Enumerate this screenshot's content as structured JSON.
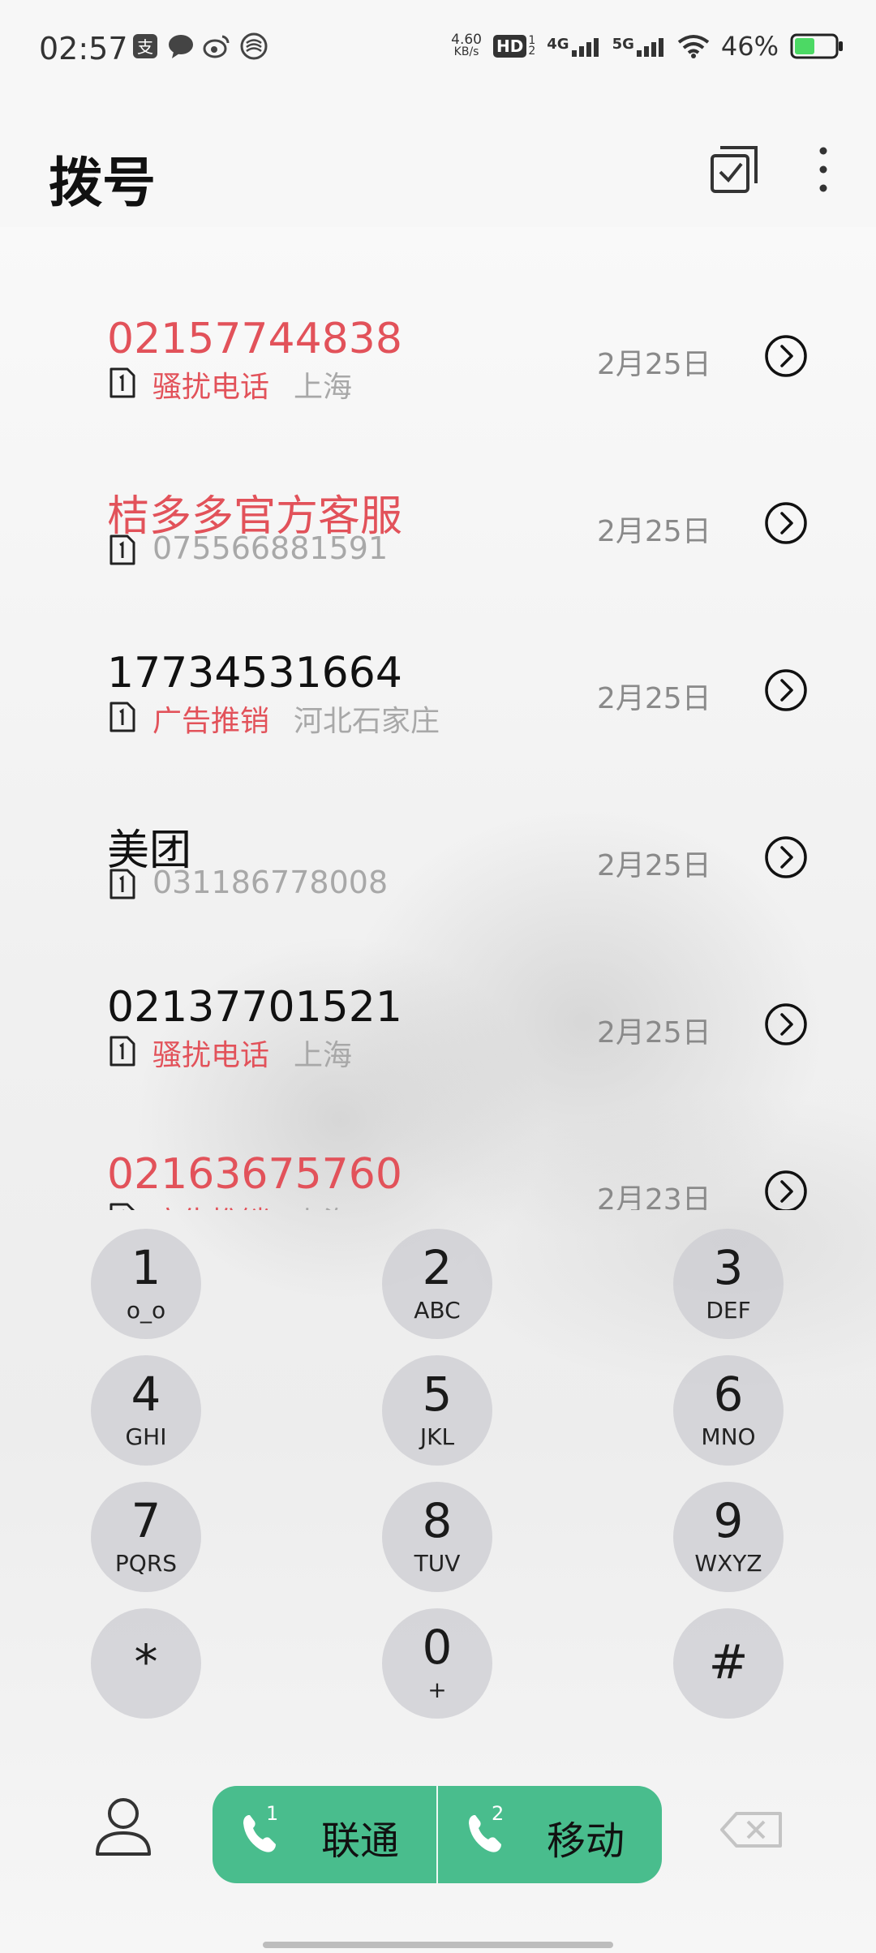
{
  "status_bar": {
    "time": "02:57",
    "net_speed_value": "4.60",
    "net_speed_unit": "KB/s",
    "hd_label": "HD",
    "network_1": "4G",
    "network_2": "5G",
    "battery": "46%",
    "icons": [
      "alipay-icon",
      "message-icon",
      "weibo-icon",
      "mobile-app-icon",
      "wifi-icon",
      "battery-icon"
    ]
  },
  "header": {
    "title": "拨号",
    "icons": [
      "multi-select-icon",
      "more-icon"
    ]
  },
  "calls": [
    {
      "name": "02157744838",
      "name_color": "red",
      "tag": "骚扰电话",
      "location": "上海",
      "number": "",
      "date": "2月25日"
    },
    {
      "name": "桔多多官方客服",
      "name_color": "red",
      "tag": "",
      "location": "",
      "number": "075566881591",
      "date": "2月25日"
    },
    {
      "name": "17734531664",
      "name_color": "black",
      "tag": "广告推销",
      "location": "河北石家庄",
      "number": "",
      "date": "2月25日"
    },
    {
      "name": "美团",
      "name_color": "black",
      "tag": "",
      "location": "",
      "number": "031186778008",
      "date": "2月25日"
    },
    {
      "name": "02137701521",
      "name_color": "black",
      "tag": "骚扰电话",
      "location": "上海",
      "number": "",
      "date": "2月25日"
    },
    {
      "name": "02163675760",
      "name_color": "red",
      "tag": "广告推销",
      "location": "上海",
      "number": "",
      "date": "2月23日"
    }
  ],
  "keypad": [
    {
      "digit": "1",
      "letters": "o_o"
    },
    {
      "digit": "2",
      "letters": "ABC"
    },
    {
      "digit": "3",
      "letters": "DEF"
    },
    {
      "digit": "4",
      "letters": "GHI"
    },
    {
      "digit": "5",
      "letters": "JKL"
    },
    {
      "digit": "6",
      "letters": "MNO"
    },
    {
      "digit": "7",
      "letters": "PQRS"
    },
    {
      "digit": "8",
      "letters": "TUV"
    },
    {
      "digit": "9",
      "letters": "WXYZ"
    },
    {
      "digit": "*",
      "letters": ""
    },
    {
      "digit": "0",
      "letters": "+"
    },
    {
      "digit": "#",
      "letters": ""
    }
  ],
  "dial_buttons": [
    {
      "sim": "1",
      "label": "联通"
    },
    {
      "sim": "2",
      "label": "移动"
    }
  ],
  "colors": {
    "accent_red": "#e2525a",
    "dial_green": "#49bd8d",
    "key_gray": "#ccccd1",
    "battery_green": "#4cd964"
  }
}
